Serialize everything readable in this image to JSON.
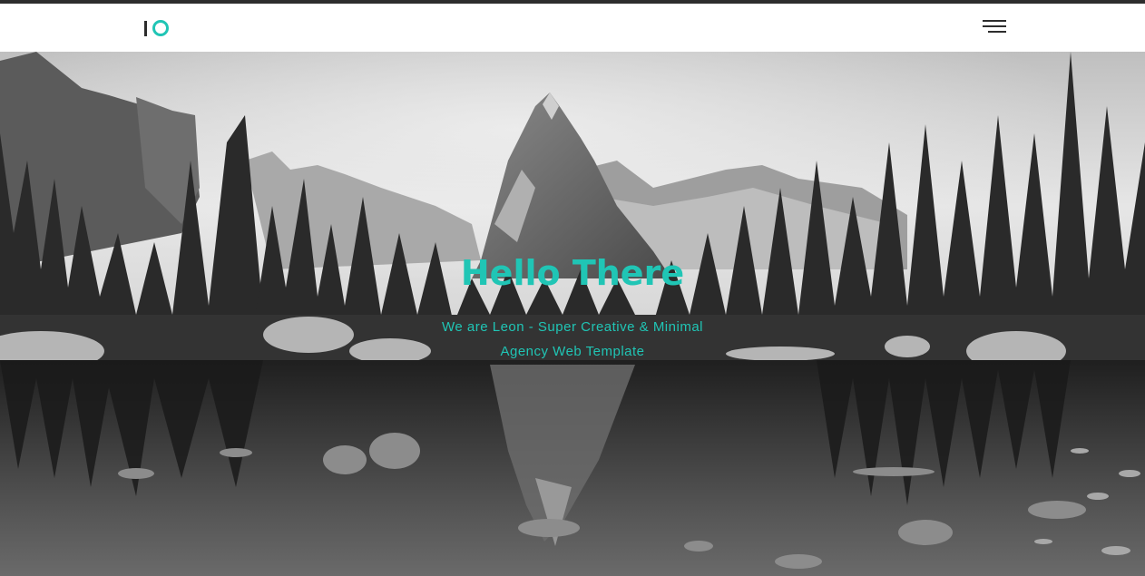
{
  "colors": {
    "accent": "#20c5b5",
    "dark": "#2d2d2d"
  },
  "header": {
    "logo_icon": "io-logo-icon",
    "menu_icon": "hamburger-menu-icon"
  },
  "hero": {
    "title": "Hello There",
    "subtitle": "We are Leon - Super Creative & Minimal Agency Web Template"
  }
}
